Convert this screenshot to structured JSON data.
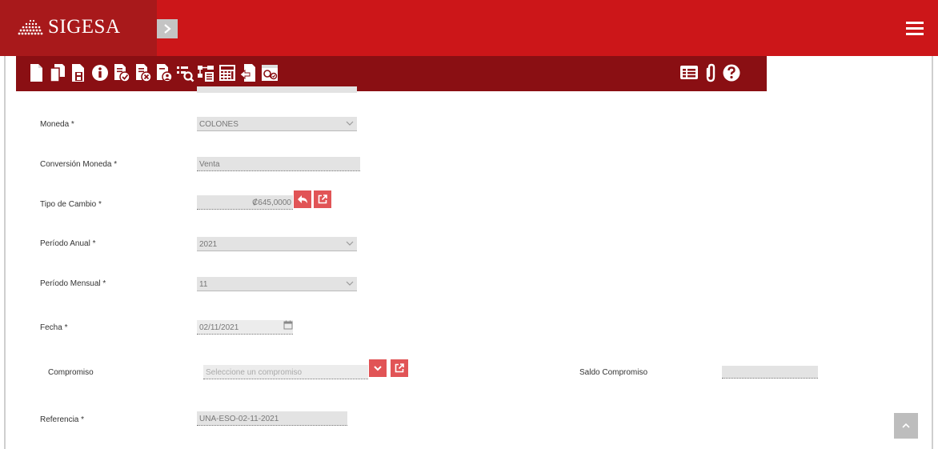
{
  "app": {
    "name": "SIGESA"
  },
  "toolbar": {
    "left_icons": [
      "new-document-icon",
      "copy-document-icon",
      "save-document-icon",
      "info-icon",
      "approve-document-icon",
      "reject-document-icon",
      "user-document-icon",
      "find-list-icon",
      "tree-search-icon",
      "calculator-icon",
      "document-return-icon",
      "document-preview-icon"
    ],
    "right_icons": [
      "list-view-icon",
      "attachment-icon",
      "help-icon"
    ]
  },
  "form": {
    "moneda": {
      "label": "Moneda *",
      "value": "COLONES"
    },
    "conversion": {
      "label": "Conversión Moneda *",
      "value": "Venta"
    },
    "tipo_cambio": {
      "label": "Tipo de Cambio *",
      "value": "₡645,0000"
    },
    "periodo_anual": {
      "label": "Período Anual *",
      "value": "2021"
    },
    "periodo_mensual": {
      "label": "Período Mensual *",
      "value": "11"
    },
    "fecha": {
      "label": "Fecha *",
      "value": "02/11/2021"
    },
    "compromiso": {
      "label": "Compromiso",
      "placeholder": "Seleccione un compromiso"
    },
    "saldo_compromiso": {
      "label": "Saldo Compromiso",
      "value": ""
    },
    "referencia": {
      "label": "Referencia *",
      "value": "UNA-ESO-02-11-2021"
    }
  },
  "colors": {
    "header": "#cc1619",
    "brand": "#a8191b",
    "toolbar": "#8a0f13",
    "action_button": "#e15456"
  }
}
